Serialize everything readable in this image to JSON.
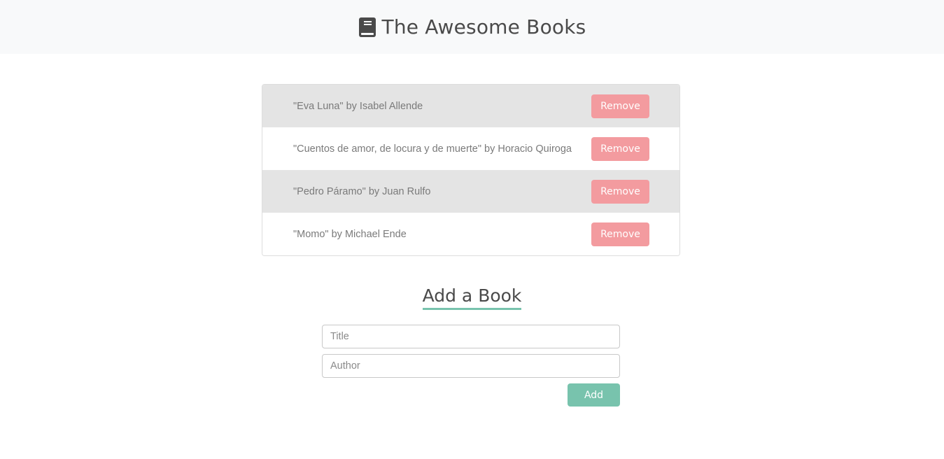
{
  "header": {
    "icon": "book-icon",
    "title": "The Awesome Books"
  },
  "books": [
    {
      "text": "\"Eva Luna\" by Isabel Allende",
      "remove_label": "Remove"
    },
    {
      "text": "\"Cuentos de amor, de locura y de muerte\" by Horacio Quiroga",
      "remove_label": "Remove"
    },
    {
      "text": "\"Pedro Páramo\" by Juan Rulfo",
      "remove_label": "Remove"
    },
    {
      "text": "\"Momo\" by Michael Ende",
      "remove_label": "Remove"
    }
  ],
  "add_form": {
    "heading": "Add a Book",
    "title_placeholder": "Title",
    "title_value": "",
    "author_placeholder": "Author",
    "author_value": "",
    "add_label": "Add"
  },
  "colors": {
    "header_bg": "#f8f9fa",
    "row_shaded": "#e4e4e4",
    "remove_button": "#f39b9f",
    "accent": "#78c3ad"
  }
}
